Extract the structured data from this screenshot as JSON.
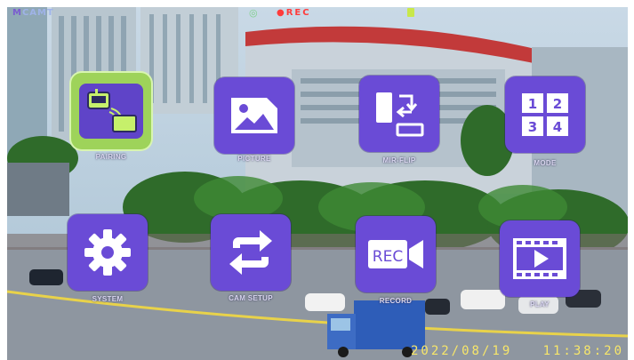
{
  "hud": {
    "logo_prefix": "M",
    "logo_text": "CAMT",
    "rec_label": "REC",
    "date": "2022/08/19",
    "time": "11:38:20"
  },
  "menu": {
    "items": [
      {
        "label": "PAIRING",
        "icon": "pairing-icon",
        "selected": true
      },
      {
        "label": "PICTURE",
        "icon": "picture-icon",
        "selected": false
      },
      {
        "label": "MIR-FLIP",
        "icon": "mirror-flip-icon",
        "selected": false
      },
      {
        "label": "MODE",
        "icon": "mode-grid-icon",
        "selected": false
      },
      {
        "label": "SYSTEM",
        "icon": "gear-icon",
        "selected": false
      },
      {
        "label": "CAM SETUP",
        "icon": "swap-arrows-icon",
        "selected": false
      },
      {
        "label": "RECORD",
        "icon": "rec-camera-icon",
        "selected": false
      },
      {
        "label": "PLAY",
        "icon": "play-film-icon",
        "selected": false
      }
    ],
    "mode_digits": [
      "1",
      "2",
      "3",
      "4"
    ],
    "rec_icon_text": "REC"
  },
  "colors": {
    "tile": "#6a4bd6",
    "tile_selected": "#9ed35a",
    "datetime": "#f7e66a",
    "rec_dot": "#ff3b3b"
  }
}
